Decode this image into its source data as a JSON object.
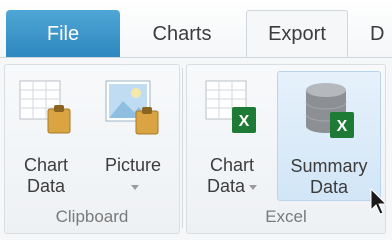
{
  "tabs": {
    "file": "File",
    "charts": "Charts",
    "export": "Export",
    "cut": "D"
  },
  "clipboard": {
    "label": "Clipboard",
    "chart_data": {
      "line1": "Chart",
      "line2": "Data"
    },
    "picture": {
      "line1": "Picture"
    }
  },
  "excel": {
    "label": "Excel",
    "chart_data": {
      "line1": "Chart",
      "line2": "Data"
    },
    "summary_data": {
      "line1": "Summary",
      "line2": "Data"
    }
  },
  "colors": {
    "file_tab": "#2d86be",
    "excel_green": "#1e7b35",
    "clip_gold": "#c99433"
  },
  "icons": [
    "table-clipboard-icon",
    "picture-clipboard-icon",
    "table-excel-icon",
    "database-excel-icon",
    "dropdown-arrow-icon",
    "mouse-pointer-icon"
  ]
}
